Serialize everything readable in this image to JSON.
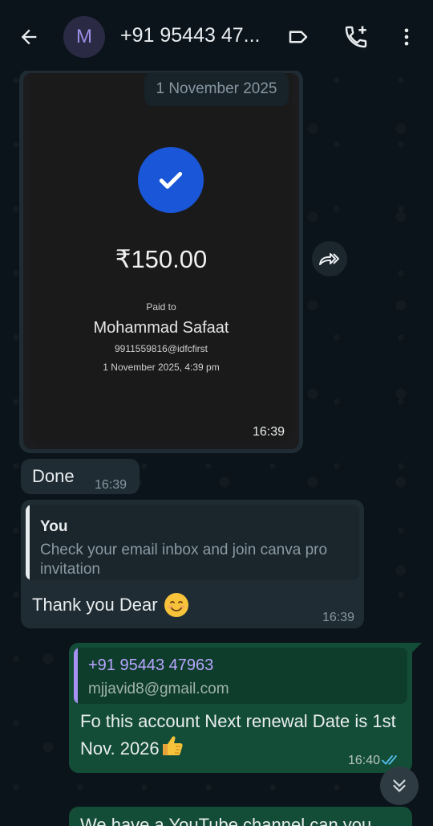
{
  "header": {
    "avatar_initial": "M",
    "contact_name": "+91 95443 47..."
  },
  "image_message": {
    "date_label": "1 November 2025",
    "amount": "₹150.00",
    "paid_to_label": "Paid to",
    "payee_name": "Mohammad Safaat",
    "payee_upi": "9911559816@idfcfirst",
    "payment_datetime": "1 November 2025, 4:39 pm",
    "time": "16:39"
  },
  "done_message": {
    "text": "Done",
    "time": "16:39"
  },
  "reply_message": {
    "quoted_author": "You",
    "quoted_text": "Check your email inbox and join canva pro invitation",
    "text": "Thank you Dear",
    "emoji": "😊",
    "time": "16:39"
  },
  "outgoing_message": {
    "quoted_author": "+91 95443 47963",
    "quoted_text": "mjjavid8@gmail.com",
    "text": "Fo this account Next renewal Date is 1st Nov. 2026",
    "emoji": "👍",
    "time": "16:40",
    "status": "read"
  },
  "partial_message": {
    "text": "We have a YouTube channel can you"
  },
  "colors": {
    "background": "#0b141a",
    "incoming_bubble": "#1f2c34",
    "outgoing_bubble": "#144d37",
    "accent_blue": "#1a56d8",
    "read_ticks": "#53bdeb"
  },
  "icons": [
    "back-arrow-icon",
    "label-icon",
    "add-call-icon",
    "more-vert-icon",
    "check-icon",
    "forward-icon",
    "double-chevron-down-icon",
    "double-check-icon"
  ]
}
